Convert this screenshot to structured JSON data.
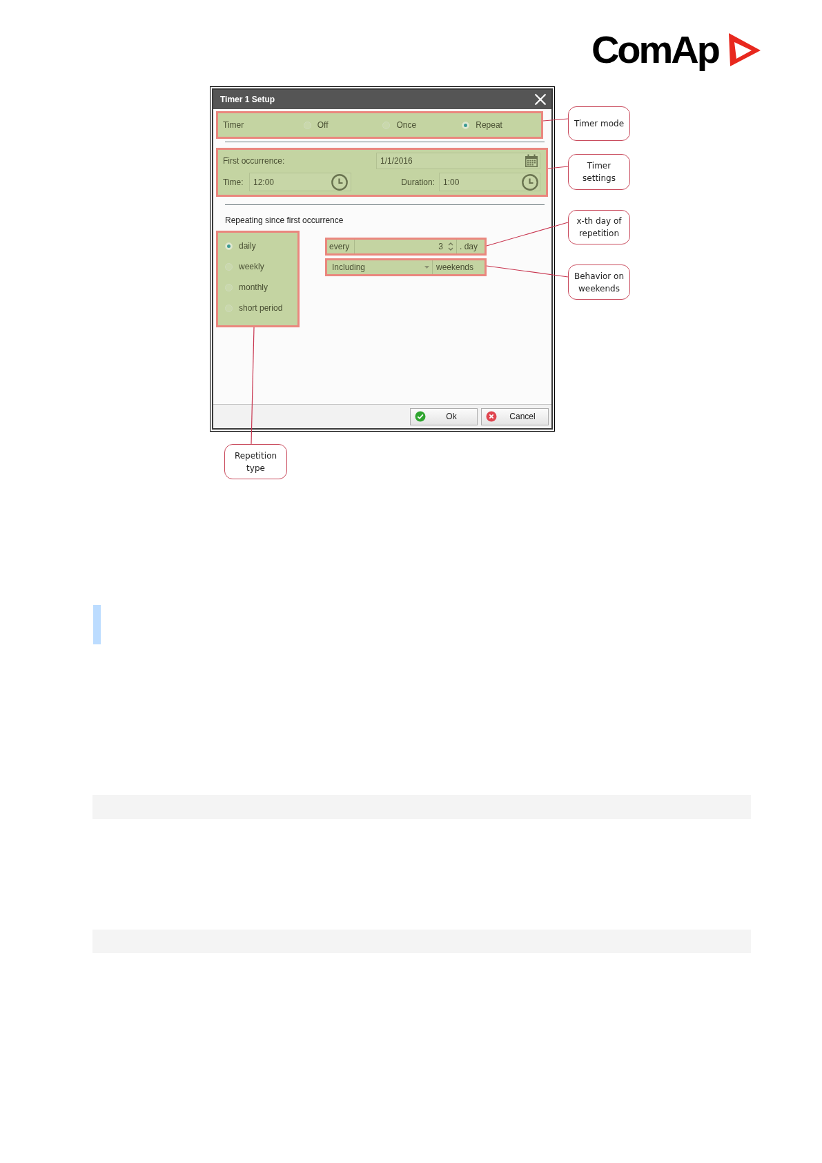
{
  "logo": {
    "text": "ComAp"
  },
  "dialog": {
    "title": "Timer 1 Setup",
    "timer_mode": {
      "label": "Timer",
      "options": [
        {
          "label": "Off",
          "selected": false
        },
        {
          "label": "Once",
          "selected": false
        },
        {
          "label": "Repeat",
          "selected": true
        }
      ]
    },
    "first_occurrence": {
      "label": "First occurrence:",
      "value": "1/1/2016"
    },
    "time": {
      "label": "Time:",
      "value": "12:00"
    },
    "duration": {
      "label": "Duration:",
      "value": "1:00"
    },
    "repeat_heading": "Repeating since first occurrence",
    "repetition_types": [
      {
        "label": "daily",
        "selected": true
      },
      {
        "label": "weekly",
        "selected": false
      },
      {
        "label": "monthly",
        "selected": false
      },
      {
        "label": "short period",
        "selected": false
      }
    ],
    "interval": {
      "prefix": "every",
      "value": "3",
      "suffix": ". day"
    },
    "weekends": {
      "value": "Including",
      "suffix": "weekends"
    },
    "buttons": [
      {
        "label": "Ok",
        "kind": "ok"
      },
      {
        "label": "Cancel",
        "kind": "cancel"
      }
    ]
  },
  "callouts": [
    "Timer mode",
    "Timer settings",
    "x-th day of repetition",
    "Behavior on weekends",
    "Repetition type"
  ]
}
